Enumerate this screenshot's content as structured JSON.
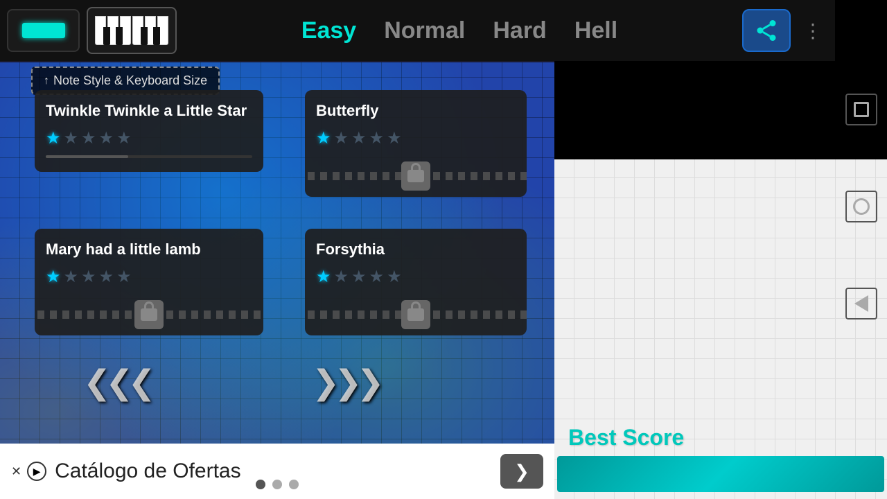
{
  "header": {
    "difficulty_tabs": [
      {
        "id": "easy",
        "label": "Easy",
        "active": true
      },
      {
        "id": "normal",
        "label": "Normal",
        "active": false
      },
      {
        "id": "hard",
        "label": "Hard",
        "active": false
      },
      {
        "id": "hell",
        "label": "Hell",
        "active": false
      }
    ],
    "share_label": "share",
    "dots_label": "⋮"
  },
  "note_style_banner": "↑ Note Style & Keyboard Size",
  "songs": [
    {
      "id": "twinkle",
      "title": "Twinkle Twinkle a Little Star",
      "stars_filled": 1,
      "stars_total": 5,
      "locked": false,
      "progress": 40
    },
    {
      "id": "butterfly",
      "title": "Butterfly",
      "stars_filled": 1,
      "stars_total": 5,
      "locked": true,
      "progress": 0
    },
    {
      "id": "mary",
      "title": "Mary had a little lamb",
      "stars_filled": 1,
      "stars_total": 5,
      "locked": true,
      "progress": 0
    },
    {
      "id": "forsythia",
      "title": "Forsythia",
      "stars_filled": 1,
      "stars_total": 5,
      "locked": true,
      "progress": 0
    }
  ],
  "nav": {
    "left_arrows": "❮❮❮",
    "right_arrows": "❯❯❯"
  },
  "right_panel": {
    "best_score_label": "Best Score"
  },
  "ad": {
    "text": "Catálogo de Ofertas",
    "forward_label": "❯",
    "dots": [
      true,
      false,
      false
    ]
  },
  "android": {
    "square": "□",
    "circle": "○",
    "back": "◁"
  }
}
